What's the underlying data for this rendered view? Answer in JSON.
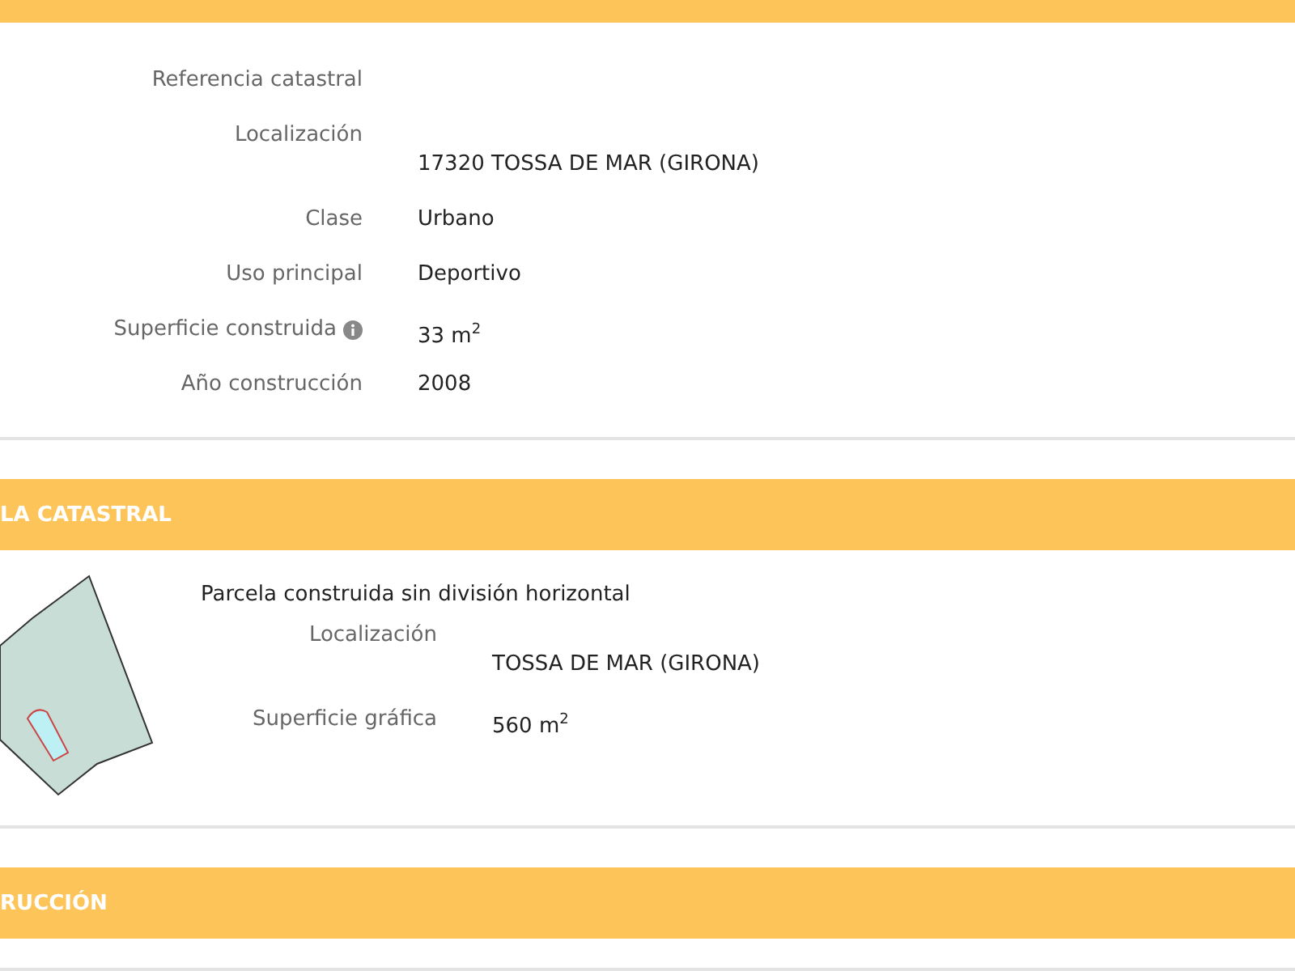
{
  "building": {
    "fields": [
      {
        "label": "Referencia catastral",
        "info": false
      },
      {
        "label": "Localización",
        "value": "17320 TOSSA DE MAR (GIRONA)",
        "info": false,
        "below": true
      },
      {
        "label": "Clase",
        "value": "Urbano",
        "info": false,
        "below": false
      },
      {
        "label": "Uso principal",
        "value": "Deportivo",
        "info": false,
        "below": false
      },
      {
        "label": "Superficie construida",
        "value": "33 m$^{2}$",
        "info": true,
        "below": false
      },
      {
        "label": "Año construcción",
        "value": "2008",
        "info": false,
        "below": false
      }
    ]
  },
  "parcel": {
    "title": "LA CATASTRAL",
    "subtitle": "Parcela construida sin división horizontal",
    "fields": [
      {
        "label": "Localización",
        "value": "TOSSA DE MAR (GIRONA)",
        "below": true
      },
      {
        "label": "Superficie gráfica",
        "value": "560 m$^{2}$",
        "below": false
      }
    ]
  },
  "construction": {
    "title": "RUCCIÓN"
  }
}
